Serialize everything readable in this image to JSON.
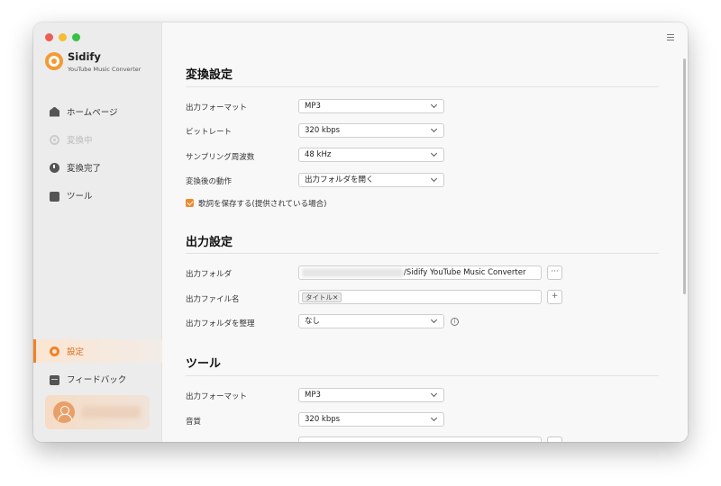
{
  "app": {
    "name": "Sidify",
    "subtitle": "YouTube Music Converter"
  },
  "sidebar": {
    "items": [
      {
        "label": "ホームページ",
        "icon": "home-icon"
      },
      {
        "label": "変換中",
        "icon": "converting-icon",
        "disabled": true
      },
      {
        "label": "変換完了",
        "icon": "clock-icon"
      },
      {
        "label": "ツール",
        "icon": "toolbox-icon"
      }
    ],
    "bottom_items": [
      {
        "label": "設定",
        "icon": "gear-icon",
        "active": true
      },
      {
        "label": "フィードバック",
        "icon": "mail-icon"
      }
    ],
    "user": {
      "avatar_icon": "user-icon"
    }
  },
  "conversion": {
    "title": "変換設定",
    "format_label": "出力フォーマット",
    "format_value": "MP3",
    "bitrate_label": "ビットレート",
    "bitrate_value": "320 kbps",
    "samplerate_label": "サンプリング周波数",
    "samplerate_value": "48 kHz",
    "after_label": "変換後の動作",
    "after_value": "出力フォルダを開く",
    "lyrics_label": "歌詞を保存する(提供されている場合)",
    "lyrics_checked": true
  },
  "output": {
    "title": "出力設定",
    "folder_label": "出力フォルダ",
    "folder_value": "/Sidify YouTube Music Converter",
    "browse_label": "···",
    "filename_label": "出力ファイル名",
    "filename_tag": "タイトル✕",
    "add_label": "+",
    "organize_label": "出力フォルダを整理",
    "organize_value": "なし",
    "info_label": "i"
  },
  "tools": {
    "title": "ツール",
    "format_label": "出力フォーマット",
    "format_value": "MP3",
    "quality_label": "音質",
    "quality_value": "320 kbps"
  },
  "colors": {
    "accent": "#f08326",
    "sidebar_bg": "#ececec",
    "main_bg": "#f8f8f8"
  }
}
